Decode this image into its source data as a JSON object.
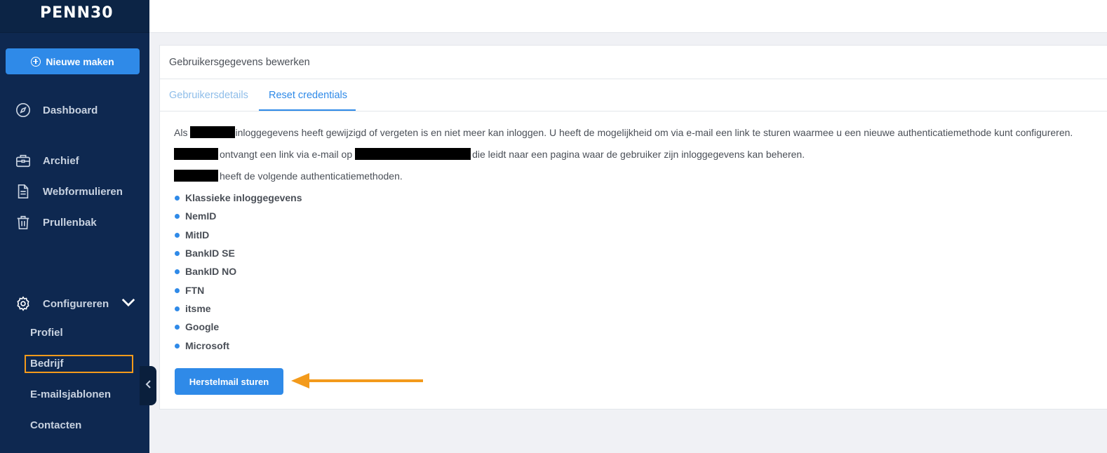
{
  "app": {
    "logo": "PENN30"
  },
  "sidebar": {
    "new_button": "Nieuwe maken",
    "items": [
      {
        "label": "Dashboard",
        "icon": "compass-icon"
      },
      {
        "label": "Archief",
        "icon": "briefcase-icon"
      },
      {
        "label": "Webformulieren",
        "icon": "document-icon"
      },
      {
        "label": "Prullenbak",
        "icon": "trash-icon"
      }
    ],
    "configure": {
      "label": "Configureren",
      "icon": "gear-icon"
    },
    "sub_items": [
      "Profiel",
      "Bedrijf",
      "E-mailsjablonen",
      "Contacten"
    ],
    "active_sub_item": "Bedrijf"
  },
  "card": {
    "title": "Gebruikersgegevens bewerken",
    "tabs": [
      "Gebruikersdetails",
      "Reset credentials"
    ],
    "active_tab": "Reset credentials",
    "para1_prefix": "Als",
    "para1_text": "inloggegevens heeft gewijzigd of vergeten is en niet meer kan inloggen. U heeft de mogelijkheid om via e-mail een link te sturen waarmee u een nieuwe authenticatiemethode kunt configureren.",
    "para2_mid": "ontvangt een link via e-mail op",
    "para2_end": "die leidt naar een pagina waar de gebruiker zijn inloggegevens kan beheren.",
    "para3_text": "heeft de volgende authenticatiemethoden.",
    "methods": [
      "Klassieke inloggegevens",
      "NemID",
      "MitID",
      "BankID SE",
      "BankID NO",
      "FTN",
      "itsme",
      "Google",
      "Microsoft"
    ],
    "reset_button": "Herstelmail sturen"
  },
  "colors": {
    "sidebar": "#0e2850",
    "accent": "#2f8ae8",
    "highlight": "#f39a1b"
  }
}
